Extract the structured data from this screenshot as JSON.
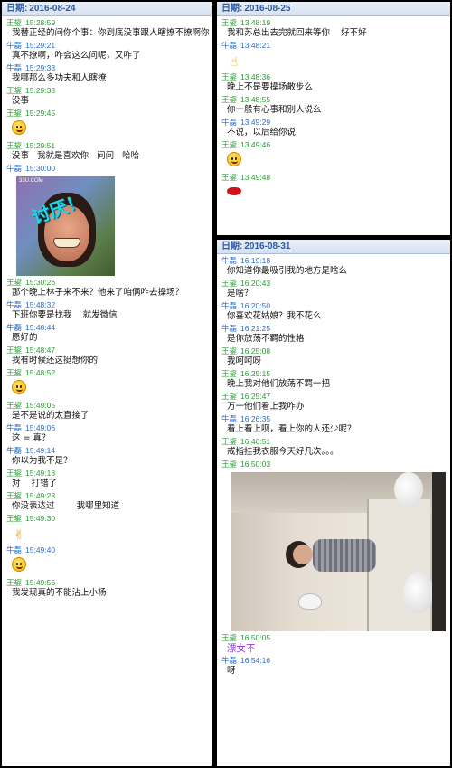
{
  "date_prefix": "日期:",
  "panels": [
    {
      "date": "2016-08-24",
      "messages": [
        {
          "sender": "王鋆",
          "time": "15:28:59",
          "text": "我替正经的问你个事：你到底没事跟人瞎撩不撩啊你"
        },
        {
          "sender": "牛磊",
          "time": "15:29:21",
          "text": "真不撩啊，咋会这么问呢，又咋了"
        },
        {
          "sender": "牛磊",
          "time": "15:29:33",
          "text": "我哪那么多功夫和人瞎撩"
        },
        {
          "sender": "王鋆",
          "time": "15:29:38",
          "text": "没事"
        },
        {
          "sender": "王鋆",
          "time": "15:29:45",
          "emoji": "thinking-face-icon"
        },
        {
          "sender": "王鋆",
          "time": "15:29:51",
          "text": "没事   我就是喜欢你   问问   哈哈"
        },
        {
          "sender": "牛磊",
          "time": "15:30:00",
          "image": "meme-photo",
          "image_caption": "讨厌！",
          "image_watermark": "33U.COM"
        },
        {
          "sender": "王鋆",
          "time": "15:30:26",
          "text": "那个晚上林子来不来？他来了咱俩咋去操场？"
        },
        {
          "sender": "牛磊",
          "time": "15:48:32",
          "text": "下班你要是找我    就发微信"
        },
        {
          "sender": "牛磊",
          "time": "15:48:44",
          "text": "愿好的"
        },
        {
          "sender": "王鋆",
          "time": "15:48:47",
          "text": "我有时候还这挺想你的"
        },
        {
          "sender": "王鋆",
          "time": "15:48:52",
          "emoji": "wink-face-icon"
        },
        {
          "sender": "王鋆",
          "time": "15:49:05",
          "text": "是不是说的太直接了"
        },
        {
          "sender": "牛磊",
          "time": "15:49:06",
          "text": "这 = 真？"
        },
        {
          "sender": "牛磊",
          "time": "15:49:14",
          "text": "你以为我不是？"
        },
        {
          "sender": "王鋆",
          "time": "15:49:18",
          "text": "对    打错了"
        },
        {
          "sender": "王鋆",
          "time": "15:49:23",
          "text": "你没表达过        我哪里知道"
        },
        {
          "sender": "王鋆",
          "time": "15:49:30",
          "emoji": "victory-hand-icon"
        },
        {
          "sender": "牛磊",
          "time": "15:49:40",
          "emoji": "grin-face-icon"
        },
        {
          "sender": "王鋆",
          "time": "15:49:56",
          "text": "我发现真的不能沾上小杨"
        }
      ]
    },
    {
      "date": "2016-08-25",
      "messages": [
        {
          "sender": "王鋆",
          "time": "13:48:19",
          "text": "我和苏总出去完就回来等你    好不好"
        },
        {
          "sender": "牛磊",
          "time": "13:48:21",
          "emoji": "thumbs-up-icon"
        },
        {
          "sender": "王鋆",
          "time": "13:48:36",
          "text": "晚上不是要操场散步么"
        },
        {
          "sender": "王鋆",
          "time": "13:48:55",
          "text": "你一般有心事和别人说么"
        },
        {
          "sender": "牛磊",
          "time": "13:49:29",
          "text": "不说，以后给你说"
        },
        {
          "sender": "王鋆",
          "time": "13:49:46",
          "emoji": "wink-face-icon"
        },
        {
          "sender": "王鋆",
          "time": "13:49:48",
          "emoji": "lips-icon"
        }
      ]
    },
    {
      "date": "2016-08-31",
      "messages": [
        {
          "sender": "牛磊",
          "time": "16:19:18",
          "text": "你知道你最吸引我的地方是啥么"
        },
        {
          "sender": "王鋆",
          "time": "16:20:43",
          "text": "是啥？"
        },
        {
          "sender": "牛磊",
          "time": "16:20:50",
          "text": "你喜欢花姑娘？我不花么"
        },
        {
          "sender": "牛磊",
          "time": "16:21:25",
          "text": "是你放荡不羁的性格"
        },
        {
          "sender": "王鋆",
          "time": "16:25:08",
          "text": "我呵呵呀"
        },
        {
          "sender": "王鋆",
          "time": "16:25:15",
          "text": "晚上我对他们放荡不羁一把"
        },
        {
          "sender": "王鋆",
          "time": "16:25:47",
          "text": "万一他们看上我咋办"
        },
        {
          "sender": "牛磊",
          "time": "16:26:35",
          "text": "看上看上呗，看上你的人还少呢？"
        },
        {
          "sender": "王鋆",
          "time": "16:46:51",
          "text": "戒指挂我衣服今天好几次。。。"
        },
        {
          "sender": "王鋆",
          "time": "16:50:03",
          "image": "mirror-selfie-photo"
        },
        {
          "sender": "王鋆",
          "time": "16:50:05",
          "text": "漂女不",
          "style": "purple"
        },
        {
          "sender": "牛磊",
          "time": "16:54:16",
          "text": "呀"
        }
      ]
    }
  ],
  "colors": {
    "王鋆": "#2b9d36",
    "牛磊": "#2c6ccb"
  }
}
